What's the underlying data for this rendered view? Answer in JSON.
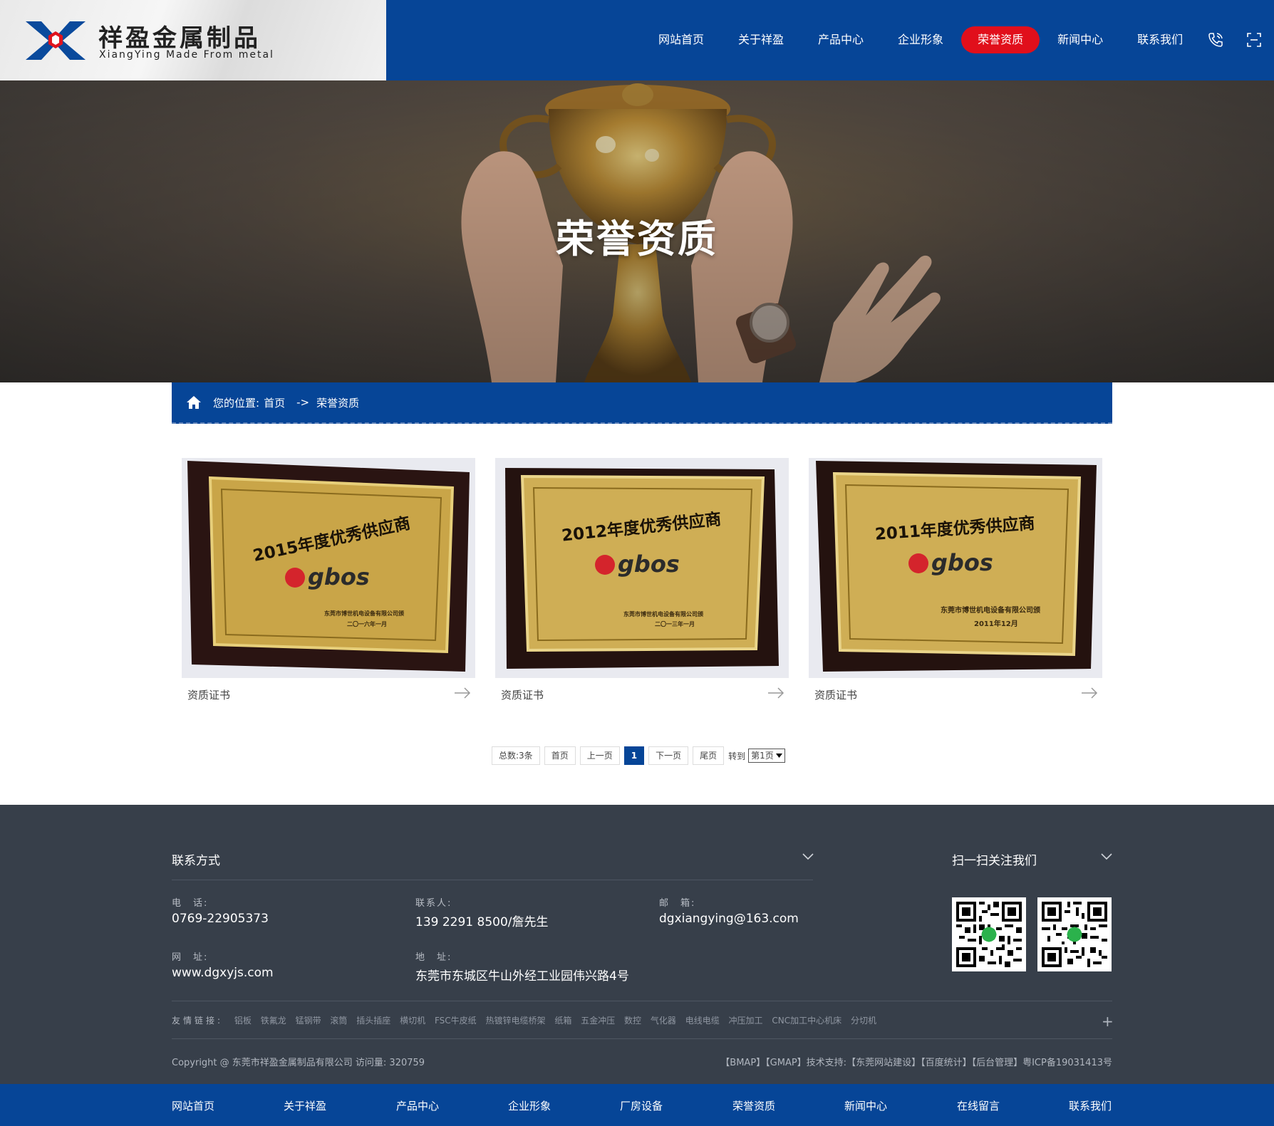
{
  "brand": {
    "name_cn": "祥盈金属制品",
    "name_en": "XiangYing Made From metal"
  },
  "colors": {
    "primary": "#064597",
    "accent": "#e10f1b",
    "footer_bg": "#373f4a"
  },
  "nav": {
    "items": [
      "网站首页",
      "关于祥盈",
      "产品中心",
      "企业形象",
      "荣誉资质",
      "新闻中心",
      "联系我们"
    ],
    "active": "荣誉资质",
    "icons": [
      "phone-icon",
      "fullscreen-icon"
    ]
  },
  "banner": {
    "title": "荣誉资质"
  },
  "breadcrumb": {
    "prefix": "您的位置:",
    "home": "首页",
    "separator": "->",
    "current": "荣誉资质"
  },
  "cards": [
    {
      "label": "资质证书",
      "plaque_title": "2015年度优秀供应商",
      "brand": "gbos",
      "issuer": "东莞市博世机电设备有限公司颁",
      "date": "二〇一六年一月"
    },
    {
      "label": "资质证书",
      "plaque_title": "2012年度优秀供应商",
      "brand": "gbos",
      "issuer": "东莞市博世机电设备有限公司颁",
      "date": "二〇一三年一月"
    },
    {
      "label": "资质证书",
      "plaque_title": "2011年度优秀供应商",
      "brand": "gbos",
      "issuer": "东莞市博世机电设备有限公司颁",
      "date": "2011年12月"
    }
  ],
  "pager": {
    "total": "总数:3条",
    "first": "首页",
    "prev": "上一页",
    "current": "1",
    "next": "下一页",
    "last": "尾页",
    "goto": "转到",
    "select_value": "第1页"
  },
  "footer": {
    "contact_heading": "联系方式",
    "qr_heading": "扫一扫关注我们",
    "phone_label": "电　话:",
    "phone": "0769-22905373",
    "contact_label": "联系人:",
    "contact": "139 2291 8500/詹先生",
    "email_label": "邮　箱:",
    "email": "dgxiangying@163.com",
    "web_label": "网　址:",
    "web": "www.dgxyjs.com",
    "addr_label": "地　址:",
    "addr": "东莞市东城区牛山外经工业园伟兴路4号",
    "links_title": "友情链接:",
    "links": [
      "铝板",
      "铁氟龙",
      "锰钢带",
      "滚筒",
      "插头插座",
      "横切机",
      "FSC牛皮纸",
      "热镀锌电缆桥架",
      "纸箱",
      "五金冲压",
      "数控",
      "气化器",
      "电线电缆",
      "冲压加工",
      "CNC加工中心机床",
      "分切机"
    ],
    "copyright": "Copyright @ 东莞市祥盈金属制品有限公司 访问量: 320759",
    "right_links": "【BMAP】【GMAP】技术支持:【东莞网站建设】【百度统计】【后台管理】粤ICP备19031413号"
  },
  "bottom_nav": [
    "网站首页",
    "关于祥盈",
    "产品中心",
    "企业形象",
    "厂房设备",
    "荣誉资质",
    "新闻中心",
    "在线留言",
    "联系我们"
  ]
}
